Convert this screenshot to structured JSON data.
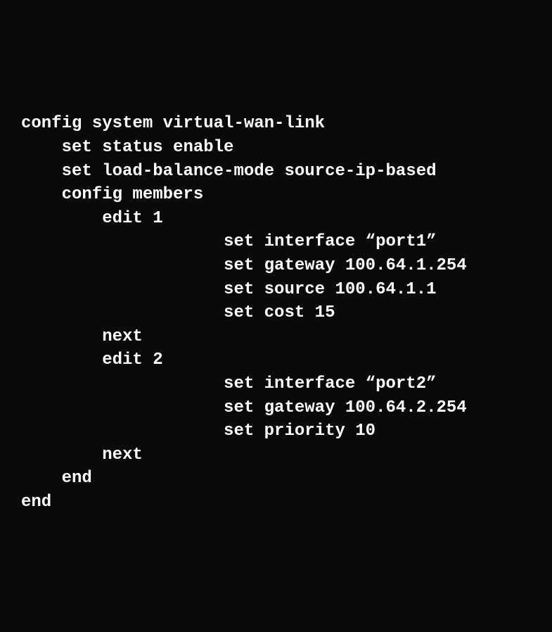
{
  "terminal": {
    "lines": [
      "config system virtual-wan-link",
      "    set status enable",
      "    set load-balance-mode source-ip-based",
      "    config members",
      "        edit 1",
      "                    set interface “port1”",
      "                    set gateway 100.64.1.254",
      "                    set source 100.64.1.1",
      "                    set cost 15",
      "        next",
      "        edit 2",
      "                    set interface “port2”",
      "                    set gateway 100.64.2.254",
      "                    set priority 10",
      "        next",
      "    end",
      "end"
    ]
  }
}
